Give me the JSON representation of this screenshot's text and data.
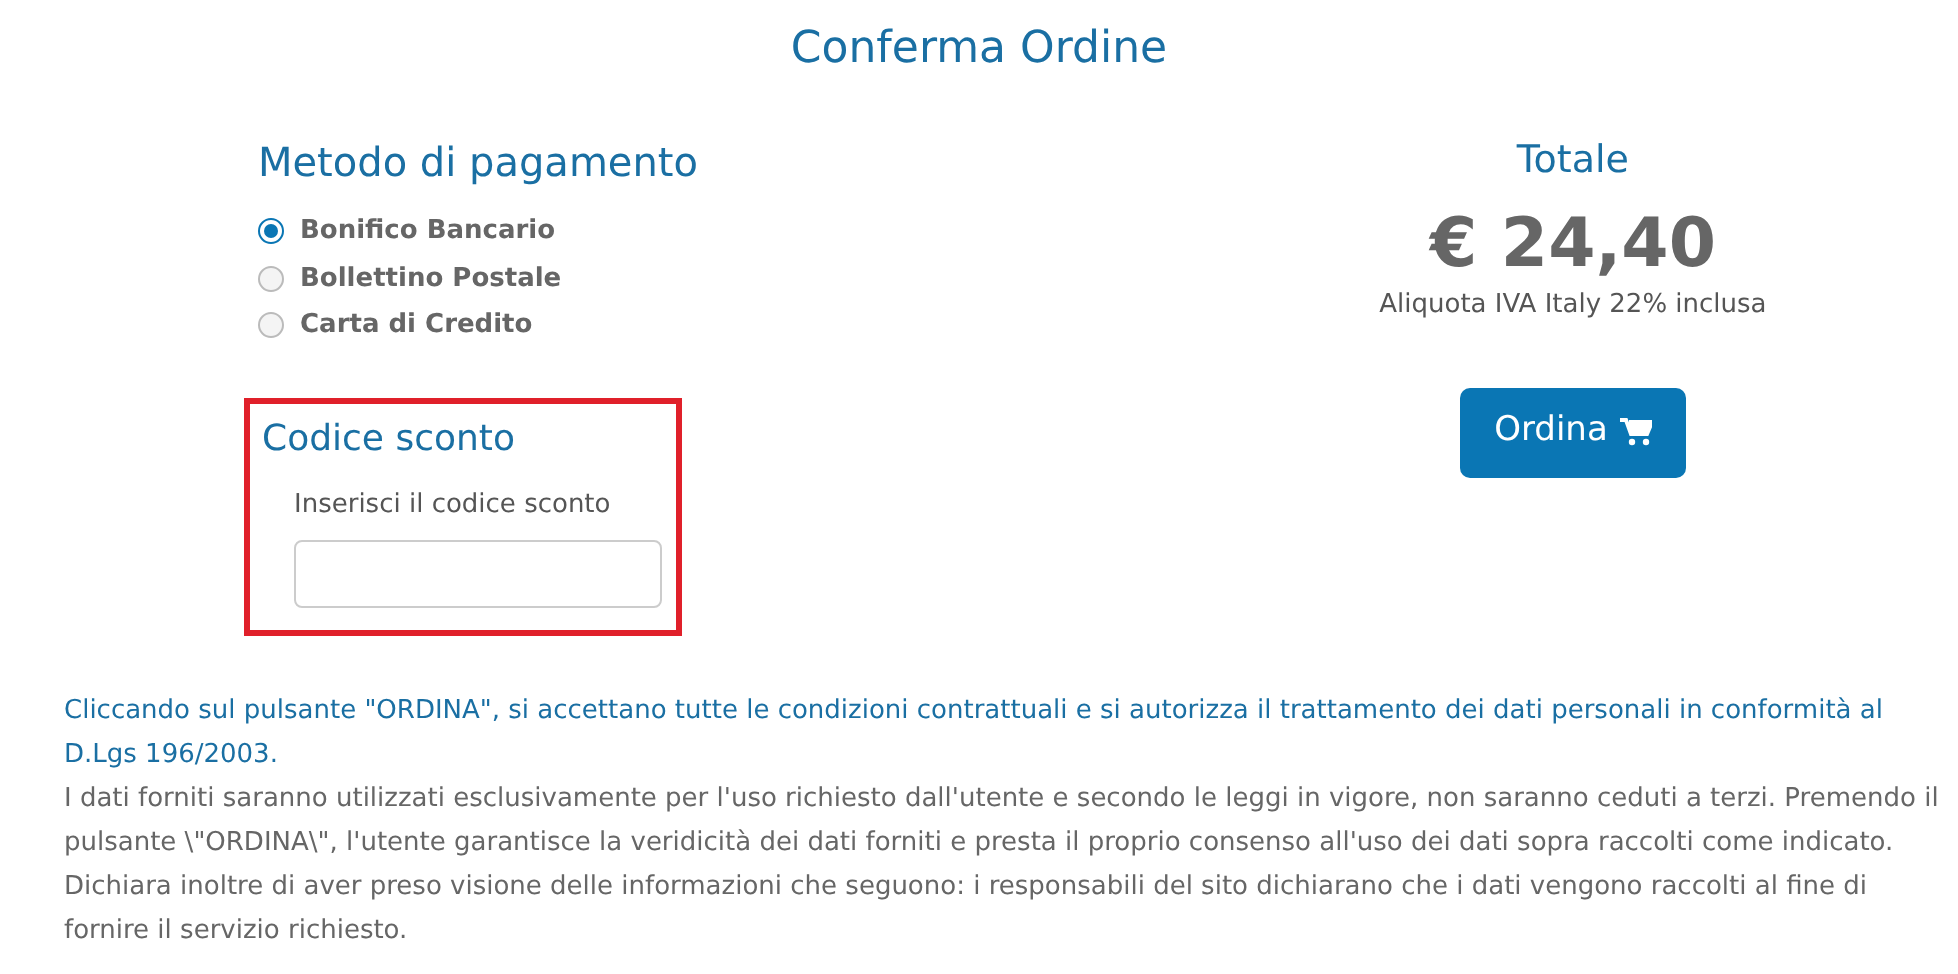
{
  "title": "Conferma Ordine",
  "payment": {
    "heading": "Metodo di pagamento",
    "options": [
      {
        "label": "Bonifico Bancario",
        "selected": true
      },
      {
        "label": "Bollettino Postale",
        "selected": false
      },
      {
        "label": "Carta di Credito",
        "selected": false
      }
    ]
  },
  "discount": {
    "heading": "Codice sconto",
    "label": "Inserisci il codice sconto",
    "highlighted": true
  },
  "total": {
    "heading": "Totale",
    "amount": "€ 24,40",
    "vat_note": "Aliquota IVA Italy 22% inclusa",
    "button": "Ordina"
  },
  "consent": "Cliccando sul pulsante \"ORDINA\", si accettano tutte le condizioni contrattuali e si autorizza il trattamento dei dati personali in conformità al D.Lgs 196/2003.",
  "privacy": "I dati forniti saranno utilizzati esclusivamente per l'uso richiesto dall'utente e secondo le leggi in vigore, non saranno ceduti a terzi. Premendo il pulsante \\\"ORDINA\\\", l'utente garantisce la veridicità dei dati forniti e presta il proprio consenso all'uso dei dati sopra raccolti come indicato. Dichiara inoltre di aver preso visione delle informazioni che seguono: i responsabili del sito dichiarano che i dati vengono raccolti al fine di fornire il servizio richiesto."
}
